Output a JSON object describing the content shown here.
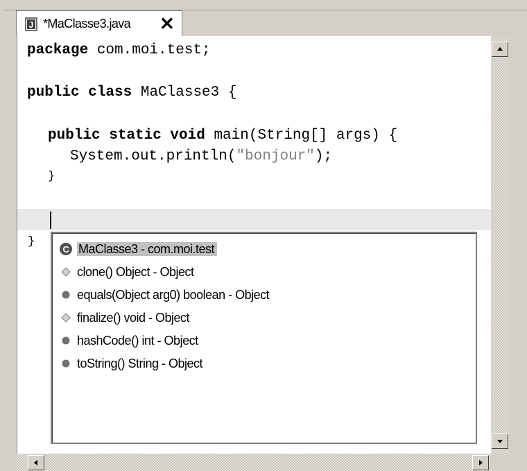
{
  "tab": {
    "title": "*MaClasse3.java",
    "close_label": "✕"
  },
  "code": {
    "l1_kw": "package",
    "l1_rest": " com.moi.test;",
    "l2_kw": "public class",
    "l2_rest": " MaClasse3 {",
    "l3_kw": "public static void",
    "l3_rest": " main(String[] args) {",
    "l4_pre": "System.out.println(",
    "l4_str": "\"bonjour\"",
    "l4_post": ");",
    "l5": "}",
    "l6": "}"
  },
  "completion": {
    "items": [
      {
        "label": "MaClasse3 - com.moi.test",
        "icon": "class-icon",
        "selected": true
      },
      {
        "label": "clone()  Object - Object",
        "icon": "protected-method-icon",
        "selected": false
      },
      {
        "label": "equals(Object arg0)  boolean - Object",
        "icon": "public-method-icon",
        "selected": false
      },
      {
        "label": "finalize()  void - Object",
        "icon": "protected-method-icon",
        "selected": false
      },
      {
        "label": "hashCode()  int - Object",
        "icon": "public-method-icon",
        "selected": false
      },
      {
        "label": "toString()  String - Object",
        "icon": "public-method-icon",
        "selected": false
      }
    ]
  }
}
